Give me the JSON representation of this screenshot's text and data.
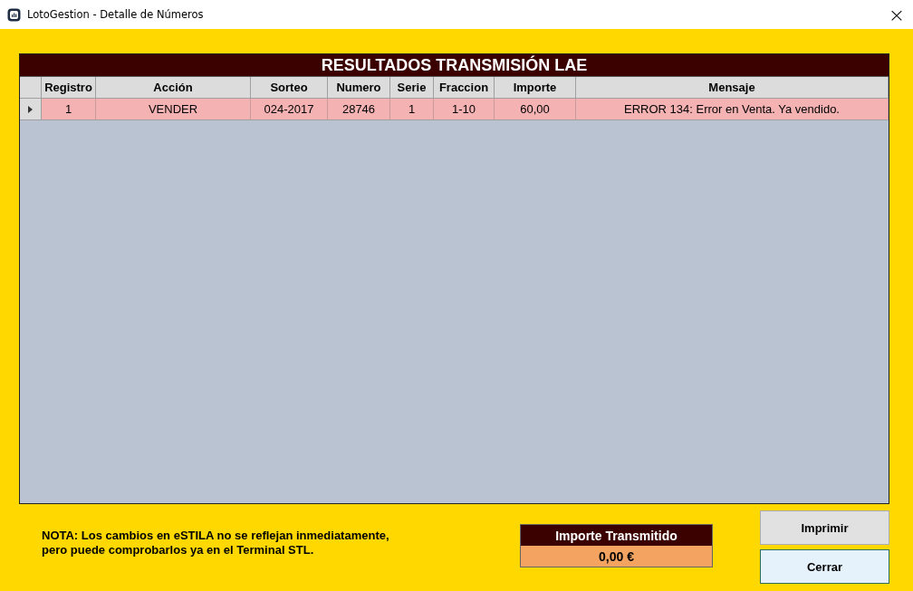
{
  "window": {
    "title": "LotoGestion - Detalle de Números",
    "close": "×"
  },
  "grid": {
    "title": "RESULTADOS TRANSMISIÓN LAE",
    "columns": [
      "Registro",
      "Acción",
      "Sorteo",
      "Numero",
      "Serie",
      "Fraccion",
      "Importe",
      "Mensaje"
    ],
    "rows": [
      {
        "selected": true,
        "cells": [
          "1",
          "VENDER",
          "024-2017",
          "28746",
          "1",
          "1-10",
          "60,00",
          "ERROR 134: Error en Venta. Ya vendido."
        ]
      }
    ]
  },
  "note": "NOTA: Los cambios en eSTILA no se reflejan inmediatamente,\npero puede comprobarlos ya en el Terminal STL.",
  "total": {
    "label": "Importe Transmitido",
    "value": "0,00 €"
  },
  "buttons": [
    {
      "label": "Imprimir",
      "focused": false
    },
    {
      "label": "Cerrar",
      "focused": true
    }
  ]
}
